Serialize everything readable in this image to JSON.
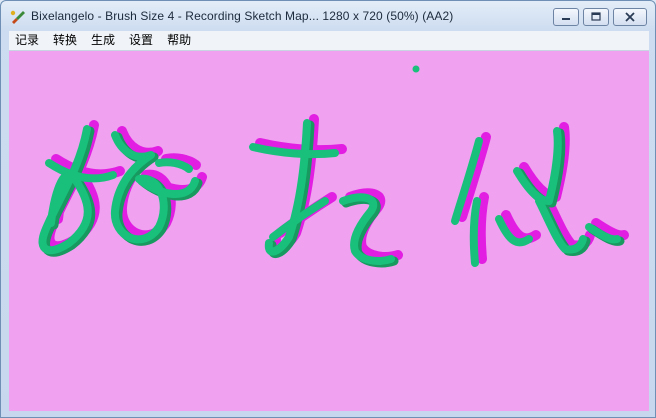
{
  "window": {
    "title": "Bixelangelo - Brush Size 4 - Recording Sketch Map... 1280 x 720 (50%) (AA2)",
    "app_icon": "paintbrush-app-icon"
  },
  "controls": {
    "minimize": "minimize-icon",
    "maximize": "maximize-icon",
    "close": "close-icon"
  },
  "menu": {
    "items": [
      "记录",
      "转换",
      "生成",
      "设置",
      "帮助"
    ]
  },
  "canvas": {
    "background_color": "#f0a2f0",
    "stroke_color": "#19c07c",
    "shadow_color": "#e21ee2",
    "handwriting_text": "好想你"
  }
}
